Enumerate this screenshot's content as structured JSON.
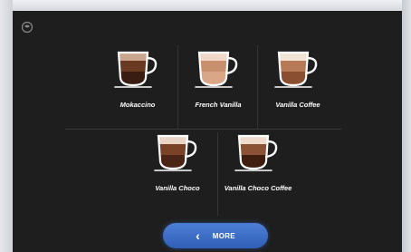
{
  "drinks": [
    {
      "label": "Mokaccino",
      "layers": [
        "#3a1d12",
        "#6b3a22",
        "#c8a58c"
      ]
    },
    {
      "label": "French Vanilla",
      "layers": [
        "#d9a788",
        "#c99070",
        "#f0d9c8"
      ]
    },
    {
      "label": "Vanilla Coffee",
      "layers": [
        "#8a4f30",
        "#b77a56",
        "#f1e3d6"
      ]
    },
    {
      "label": "Vanilla Choco",
      "layers": [
        "#4a2414",
        "#7a4226",
        "#e9d6c6"
      ]
    },
    {
      "label": "Vanilla Choco Coffee",
      "layers": [
        "#3f1e10",
        "#8b5236",
        "#efdccd"
      ]
    }
  ],
  "more_button": {
    "label": "MORE",
    "chevron": "‹"
  },
  "icons": {
    "logo": "coffee-maker-logo-icon",
    "cup": "coffee-cup-icon"
  }
}
